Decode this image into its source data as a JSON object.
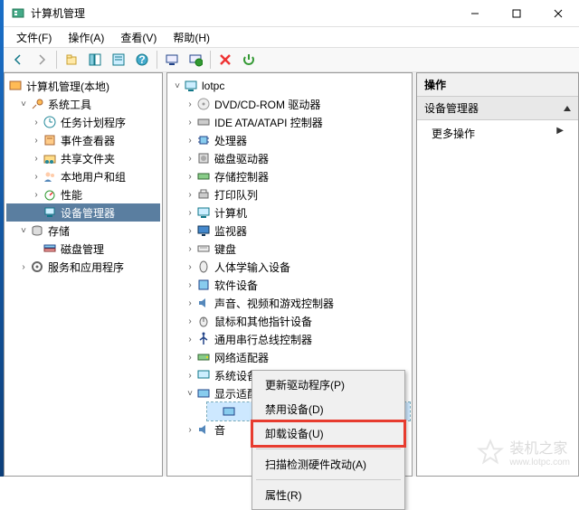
{
  "window": {
    "title": "计算机管理",
    "minimize": "–",
    "maximize": "□",
    "close": "×"
  },
  "menu": {
    "file": "文件(F)",
    "action": "操作(A)",
    "view": "查看(V)",
    "help": "帮助(H)"
  },
  "left_tree": {
    "root": "计算机管理(本地)",
    "system_tools": "系统工具",
    "task_scheduler": "任务计划程序",
    "event_viewer": "事件查看器",
    "shared_folders": "共享文件夹",
    "local_users": "本地用户和组",
    "performance": "性能",
    "device_manager": "设备管理器",
    "storage": "存储",
    "disk_mgmt": "磁盘管理",
    "services_apps": "服务和应用程序"
  },
  "mid_tree": {
    "host": "lotpc",
    "dvd": "DVD/CD-ROM 驱动器",
    "ide": "IDE ATA/ATAPI 控制器",
    "cpu": "处理器",
    "disk_drive": "磁盘驱动器",
    "storage_ctrl": "存储控制器",
    "print_queue": "打印队列",
    "computer": "计算机",
    "monitor": "监视器",
    "keyboard": "键盘",
    "hid": "人体学输入设备",
    "software_dev": "软件设备",
    "sound": "声音、视频和游戏控制器",
    "mouse": "鼠标和其他指针设备",
    "usb": "通用串行总线控制器",
    "network": "网络适配器",
    "system_dev": "系统设备",
    "display": "显示适配器",
    "audio": "音频..."
  },
  "actions": {
    "header": "操作",
    "dm": "设备管理器",
    "more": "更多操作"
  },
  "ctx": {
    "update": "更新驱动程序(P)",
    "disable": "禁用设备(D)",
    "uninstall": "卸载设备(U)",
    "scan": "扫描检测硬件改动(A)",
    "props": "属性(R)"
  },
  "watermark": {
    "site": "www.lotpc.com",
    "brand": "装机之家"
  }
}
